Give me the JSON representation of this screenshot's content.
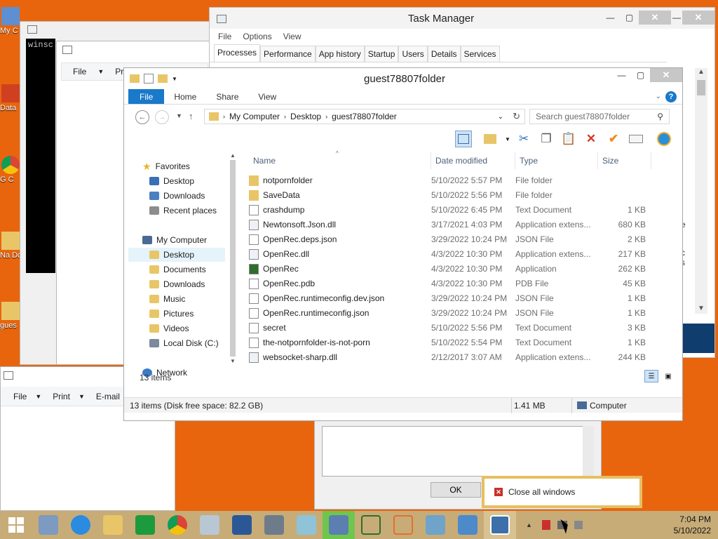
{
  "desktop": {
    "icons": [
      {
        "label": "My C"
      },
      {
        "label": "Data"
      },
      {
        "label": "G C"
      },
      {
        "label": "Na Do"
      },
      {
        "label": "gues"
      }
    ]
  },
  "cmd_window": {
    "text": "winsc"
  },
  "bg_window_menu": {
    "file": "File",
    "pr": "Pr"
  },
  "bg_window2_menu": {
    "file": "File",
    "print": "Print",
    "email": "E-mail"
  },
  "task_manager": {
    "title": "Task Manager",
    "menu": [
      "File",
      "Options",
      "View"
    ],
    "tabs": [
      "Processes",
      "Performance",
      "App history",
      "Startup",
      "Users",
      "Details",
      "Services"
    ],
    "side_text": [
      "e",
      "c",
      "s"
    ]
  },
  "dialog": {
    "ok_label": "OK"
  },
  "explorer": {
    "title": "guest78807folder",
    "ribbon_tabs": [
      "File",
      "Home",
      "Share",
      "View"
    ],
    "breadcrumb": [
      "My Computer",
      "Desktop",
      "guest78807folder"
    ],
    "search_placeholder": "Search guest78807folder",
    "columns": {
      "name": "Name",
      "date": "Date modified",
      "type": "Type",
      "size": "Size"
    },
    "nav": {
      "favorites": "Favorites",
      "fav_items": [
        "Desktop",
        "Downloads",
        "Recent places"
      ],
      "computer": "My Computer",
      "comp_items": [
        "Desktop",
        "Documents",
        "Downloads",
        "Music",
        "Pictures",
        "Videos",
        "Local Disk (C:)"
      ],
      "network": "Network"
    },
    "files": [
      {
        "name": "notpornfolder",
        "date": "5/10/2022 5:57 PM",
        "type": "File folder",
        "size": "",
        "icon": "folder-icon"
      },
      {
        "name": "SaveData",
        "date": "5/10/2022 5:56 PM",
        "type": "File folder",
        "size": "",
        "icon": "folder-icon"
      },
      {
        "name": "crashdump",
        "date": "5/10/2022 6:45 PM",
        "type": "Text Document",
        "size": "1 KB",
        "icon": "document-icon"
      },
      {
        "name": "Newtonsoft.Json.dll",
        "date": "3/17/2021 4:03 PM",
        "type": "Application extens...",
        "size": "680 KB",
        "icon": "dll-icon"
      },
      {
        "name": "OpenRec.deps.json",
        "date": "3/29/2022 10:24 PM",
        "type": "JSON File",
        "size": "2 KB",
        "icon": "document-icon"
      },
      {
        "name": "OpenRec.dll",
        "date": "4/3/2022 10:30 PM",
        "type": "Application extens...",
        "size": "217 KB",
        "icon": "dll-icon"
      },
      {
        "name": "OpenRec",
        "date": "4/3/2022 10:30 PM",
        "type": "Application",
        "size": "262 KB",
        "icon": "app-icon"
      },
      {
        "name": "OpenRec.pdb",
        "date": "4/3/2022 10:30 PM",
        "type": "PDB File",
        "size": "45 KB",
        "icon": "document-icon"
      },
      {
        "name": "OpenRec.runtimeconfig.dev.json",
        "date": "3/29/2022 10:24 PM",
        "type": "JSON File",
        "size": "1 KB",
        "icon": "document-icon"
      },
      {
        "name": "OpenRec.runtimeconfig.json",
        "date": "3/29/2022 10:24 PM",
        "type": "JSON File",
        "size": "1 KB",
        "icon": "document-icon"
      },
      {
        "name": "secret",
        "date": "5/10/2022 5:56 PM",
        "type": "Text Document",
        "size": "3 KB",
        "icon": "document-icon"
      },
      {
        "name": "the-notpornfolder-is-not-porn",
        "date": "5/10/2022 5:54 PM",
        "type": "Text Document",
        "size": "1 KB",
        "icon": "document-icon"
      },
      {
        "name": "websocket-sharp.dll",
        "date": "2/12/2017 3:07 AM",
        "type": "Application extens...",
        "size": "244 KB",
        "icon": "dll-icon"
      }
    ],
    "item_count": "13 items",
    "status_left": "13 items (Disk free space: 82.2 GB)",
    "status_size": "1.41 MB",
    "status_location": "Computer"
  },
  "tooltip": {
    "label": "Close all windows"
  },
  "clock": {
    "time": "7:04 PM",
    "date": "5/10/2022"
  },
  "colors": {
    "accent": "#1979ca",
    "taskbar": "#c7ac78",
    "desktop": "#e8650e",
    "tooltip_border": "#e7bf60"
  }
}
